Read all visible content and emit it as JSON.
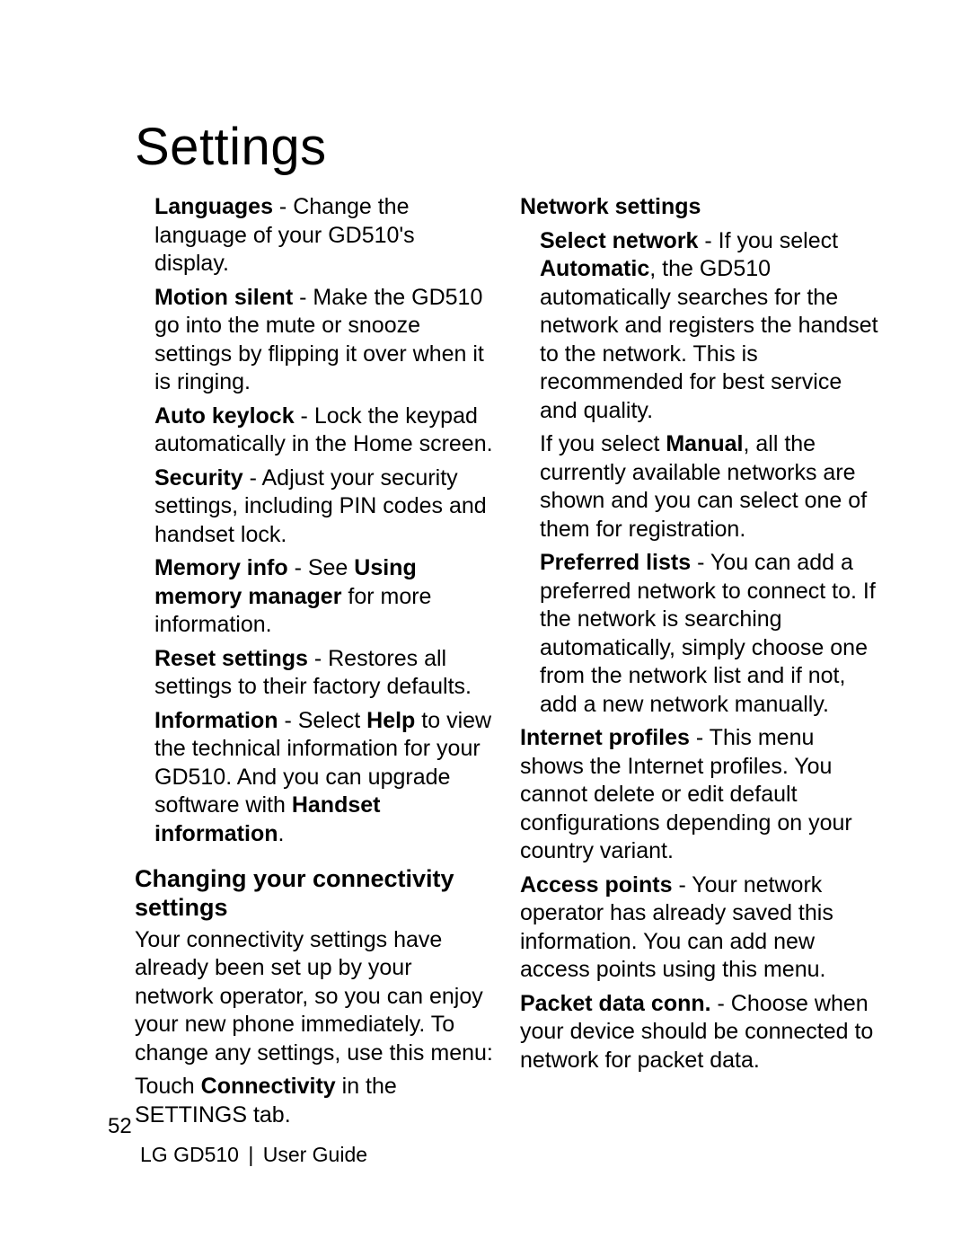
{
  "title": "Settings",
  "left": {
    "languages_b": "Languages",
    "languages_t": " - Change the language of your GD510's display.",
    "motion_b": "Motion silent",
    "motion_t": " - Make the GD510 go into the mute or snooze settings by flipping it over when it is ringing.",
    "autokey_b": "Auto keylock",
    "autokey_t": " - Lock the keypad automatically in the Home screen.",
    "security_b": "Security",
    "security_t": " - Adjust your security settings, including PIN codes and handset lock.",
    "memory_b": "Memory info",
    "memory_t1": " - See ",
    "memory_b2": "Using memory manager",
    "memory_t2": " for more information.",
    "reset_b": "Reset settings",
    "reset_t": " - Restores all settings to their factory defaults.",
    "info_b": "Information",
    "info_t1": " - Select ",
    "info_b2": "Help",
    "info_t2": " to view the technical information for your GD510. And you can upgrade software with ",
    "info_b3": "Handset information",
    "info_t3": ".",
    "sub": "Changing your connectivity settings",
    "conn_p1": "Your connectivity settings have already been set up by your network operator, so you can enjoy your new phone immediately. To change any settings, use this menu:",
    "conn_p2a": "Touch ",
    "conn_p2b": "Connectivity",
    "conn_p2c": " in the SETTINGS tab."
  },
  "right": {
    "net_b": "Network settings",
    "sel_b": "Select network",
    "sel_t1": " -  If you select ",
    "sel_b2": "Automatic",
    "sel_t2": ", the GD510 automatically searches for the network and registers the handset to the network. This is recommended for best service and quality.",
    "sel_t3a": "If you select ",
    "sel_b3": "Manual",
    "sel_t3b": ", all the currently available networks are shown and you can select one of them for registration.",
    "pref_b": "Preferred lists",
    "pref_t": " - You can add a preferred network to connect to.  If the network is searching automatically, simply choose one from the network list and if not, add a new network manually.",
    "ip_b": "Internet profiles",
    "ip_t": " - This menu shows the Internet profiles. You cannot delete or edit default configurations depending on your country variant.",
    "ap_b": "Access points",
    "ap_t": " - Your network operator has already saved this information. You can add new access points using this menu.",
    "pd_b": "Packet data conn.",
    "pd_t": " - Choose when your device should be connected to network for packet data."
  },
  "footer": {
    "page": "52",
    "model": "LG GD510",
    "guide": "User Guide"
  }
}
